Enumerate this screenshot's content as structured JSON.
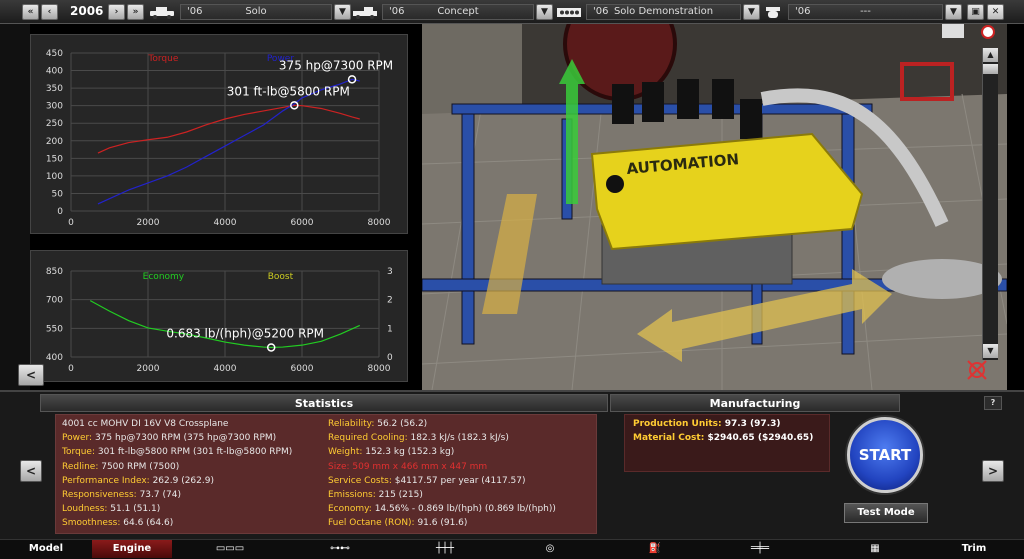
{
  "topbar": {
    "year": "2006",
    "model": {
      "year": "'06",
      "name": "Solo"
    },
    "trim": {
      "year": "'06",
      "name": "Concept"
    },
    "engine": {
      "year": "'06",
      "name": "Solo Demonstration"
    },
    "variant": {
      "year": "'06",
      "name": "---"
    },
    "icons": [
      "chevron-double-left-icon",
      "chevron-left-icon",
      "chevron-right-icon",
      "chevron-double-right-icon",
      "car-icon",
      "dropdown-icon",
      "pickup-icon",
      "engine-block-icon",
      "turbo-icon",
      "save-icon",
      "close-icon"
    ]
  },
  "chart_data": [
    {
      "type": "line",
      "x": [
        700,
        1000,
        1500,
        2000,
        2500,
        3000,
        3500,
        4000,
        4500,
        5000,
        5500,
        5800,
        6000,
        6500,
        7000,
        7300,
        7500
      ],
      "series": [
        {
          "name": "Torque",
          "color": "#cc2222",
          "axis": "left",
          "values": [
            165,
            180,
            195,
            203,
            210,
            225,
            245,
            262,
            275,
            285,
            295,
            301,
            300,
            292,
            278,
            268,
            262
          ]
        },
        {
          "name": "Power",
          "color": "#2222cc",
          "axis": "left",
          "values": [
            20,
            35,
            60,
            80,
            100,
            125,
            155,
            185,
            215,
            245,
            285,
            305,
            322,
            345,
            362,
            375,
            370
          ]
        }
      ],
      "xlim": [
        0,
        8000
      ],
      "ylim": [
        0,
        450
      ],
      "xticks": [
        0,
        2000,
        4000,
        6000,
        8000
      ],
      "yticks": [
        0,
        50,
        100,
        150,
        200,
        250,
        300,
        350,
        400,
        450
      ],
      "annotations": [
        {
          "label": "375 hp@7300 RPM",
          "x": 7300,
          "y": 375,
          "series": "Power"
        },
        {
          "label": "301 ft-lb@5800 RPM",
          "x": 5800,
          "y": 301,
          "series": "Torque"
        }
      ],
      "grid": true
    },
    {
      "type": "line",
      "x": [
        500,
        1000,
        1500,
        2000,
        2500,
        3000,
        3500,
        4000,
        4500,
        5000,
        5200,
        5500,
        6000,
        6500,
        7000,
        7500
      ],
      "series": [
        {
          "name": "Economy",
          "color": "#22cc22",
          "axis": "left",
          "values": [
            695,
            640,
            590,
            552,
            535,
            520,
            500,
            478,
            462,
            452,
            450,
            452,
            462,
            482,
            520,
            565
          ]
        },
        {
          "name": "Boost",
          "color": "#cccc22",
          "axis": "right",
          "values": []
        }
      ],
      "xlim": [
        0,
        8000
      ],
      "ylim": [
        400,
        850
      ],
      "y2lim": [
        0,
        3
      ],
      "xticks": [
        0,
        2000,
        4000,
        6000,
        8000
      ],
      "yticks": [
        400,
        550,
        700,
        850
      ],
      "y2ticks": [
        0,
        1,
        2,
        3
      ],
      "annotations": [
        {
          "label": "0.683 lb/(hph)@5200 RPM",
          "x": 5200,
          "y": 450,
          "series": "Economy"
        }
      ],
      "grid": true
    }
  ],
  "statistics": {
    "title": "Statistics",
    "left": [
      {
        "label": "",
        "value": "4001 cc MOHV DI 16V V8 Crossplane"
      },
      {
        "label": "Power: ",
        "value": "375 hp@7300 RPM (375 hp@7300 RPM)"
      },
      {
        "label": "Torque: ",
        "value": "301 ft-lb@5800 RPM (301 ft-lb@5800 RPM)"
      },
      {
        "label": "Redline: ",
        "value": "7500 RPM (7500)"
      },
      {
        "label": "Performance Index: ",
        "value": "262.9 (262.9)"
      },
      {
        "label": "Responsiveness: ",
        "value": "73.7 (74)"
      },
      {
        "label": "Loudness: ",
        "value": "51.1 (51.1)"
      },
      {
        "label": "Smoothness: ",
        "value": "64.6 (64.6)"
      }
    ],
    "right": [
      {
        "label": "Reliability: ",
        "value": "56.2 (56.2)"
      },
      {
        "label": "Required Cooling: ",
        "value": "182.3 kJ/s (182.3 kJ/s)"
      },
      {
        "label": "Weight: ",
        "value": "152.3 kg (152.3 kg)"
      },
      {
        "label": "Size: ",
        "value": "509 mm x 466 mm x 447 mm",
        "warn": true
      },
      {
        "label": "Service Costs: ",
        "value": "$4117.57 per year (4117.57)"
      },
      {
        "label": "Emissions: ",
        "value": "215 (215)"
      },
      {
        "label": "Economy: ",
        "value": "14.56% - 0.869 lb/(hph) (0.869 lb/(hph))"
      },
      {
        "label": "Fuel Octane (RON): ",
        "value": "91.6 (91.6)"
      }
    ]
  },
  "manufacturing": {
    "title": "Manufacturing",
    "items": [
      {
        "label": "Production Units: ",
        "value": "97.3 (97.3)"
      },
      {
        "label": "Material Cost: ",
        "value": "$2940.65 ($2940.65)"
      }
    ]
  },
  "actions": {
    "start": "START",
    "test_mode": "Test Mode",
    "help": "?"
  },
  "nav": {
    "model": "Model",
    "engine": "Engine",
    "trim": "Trim",
    "icons": [
      "engine-block-icon",
      "crankshaft-icon",
      "cylinder-head-icon",
      "turbo-icon",
      "fuel-system-icon",
      "exhaust-icon",
      "ecu-icon"
    ]
  },
  "viewport": {
    "brand_text": "AUTOMATION"
  }
}
